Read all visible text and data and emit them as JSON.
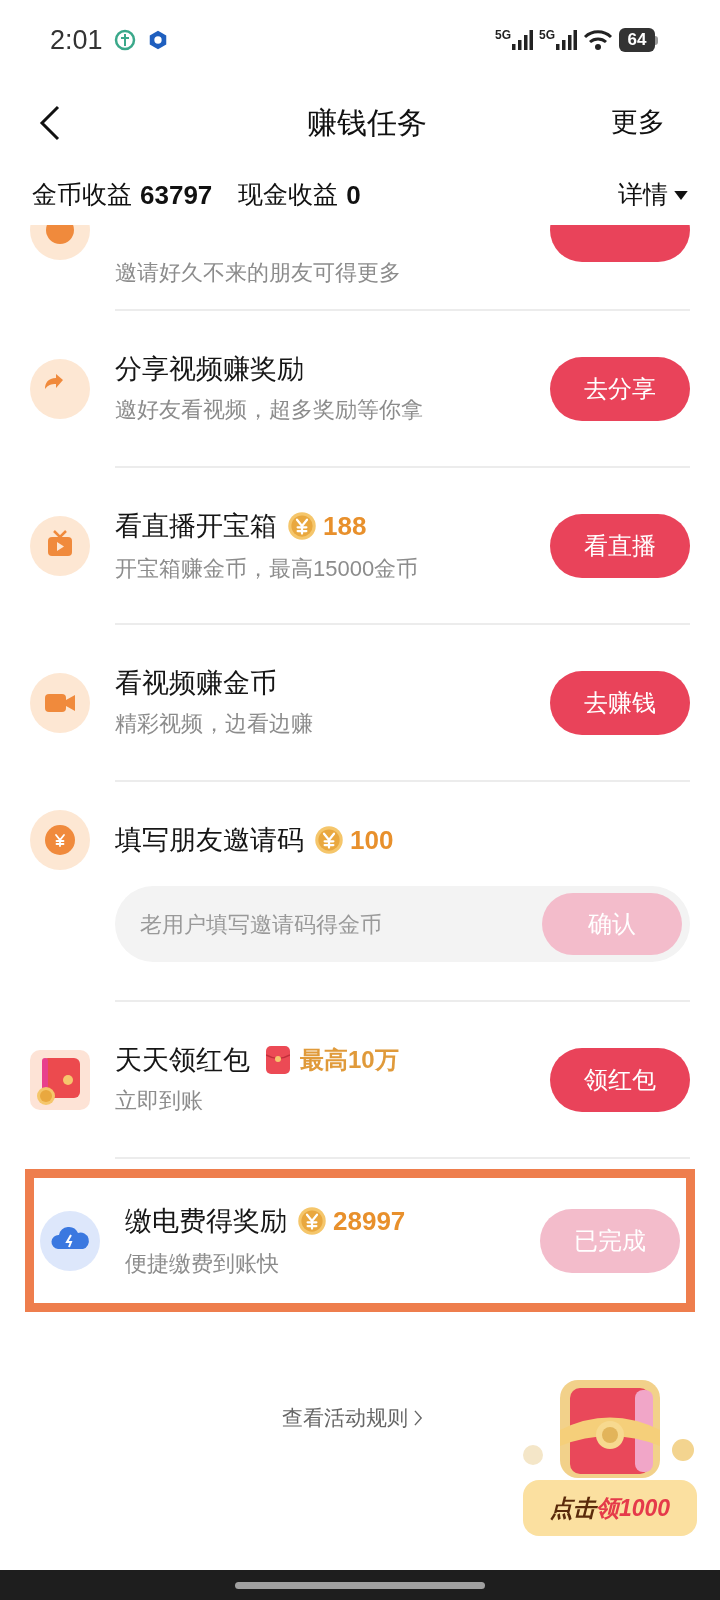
{
  "status_bar": {
    "time": "2:01",
    "networks": [
      "5G",
      "5G"
    ],
    "battery": "64"
  },
  "header": {
    "title": "赚钱任务",
    "action": "更多"
  },
  "earnings": {
    "coin_label": "金币收益",
    "coin_value": "63797",
    "cash_label": "现金收益",
    "cash_value": "0",
    "details": "详情"
  },
  "tasks": [
    {
      "kind": "clipped",
      "subtitle": "邀请好久不来的朋友可得更多",
      "highlighted": false
    },
    {
      "kind": "task",
      "title": "分享视频赚奖励",
      "subtitle": "邀好友看视频，超多奖励等你拿",
      "button": "去分享",
      "done": false,
      "highlighted": false
    },
    {
      "kind": "task",
      "title": "看直播开宝箱",
      "reward": "188",
      "subtitle": "开宝箱赚金币，最高15000金币",
      "button": "看直播",
      "done": false,
      "highlighted": false
    },
    {
      "kind": "task",
      "title": "看视频赚金币",
      "subtitle": "精彩视频，边看边赚",
      "button": "去赚钱",
      "done": false,
      "highlighted": false
    },
    {
      "kind": "code",
      "title": "填写朋友邀请码",
      "reward": "100",
      "placeholder": "老用户填写邀请码得金币",
      "button": "确认",
      "disabled": true,
      "highlighted": false
    },
    {
      "kind": "task",
      "title": "天天领红包",
      "badge": "最高10万",
      "subtitle": "立即到账",
      "button": "领红包",
      "done": false,
      "highlighted": false
    },
    {
      "kind": "task",
      "title": "缴电费得奖励",
      "reward": "28997",
      "subtitle": "便捷缴费到账快",
      "button": "已完成",
      "done": true,
      "highlighted": true
    }
  ],
  "rules_link": "查看活动规则",
  "promo": {
    "label": "点击",
    "amount": "领1000"
  }
}
